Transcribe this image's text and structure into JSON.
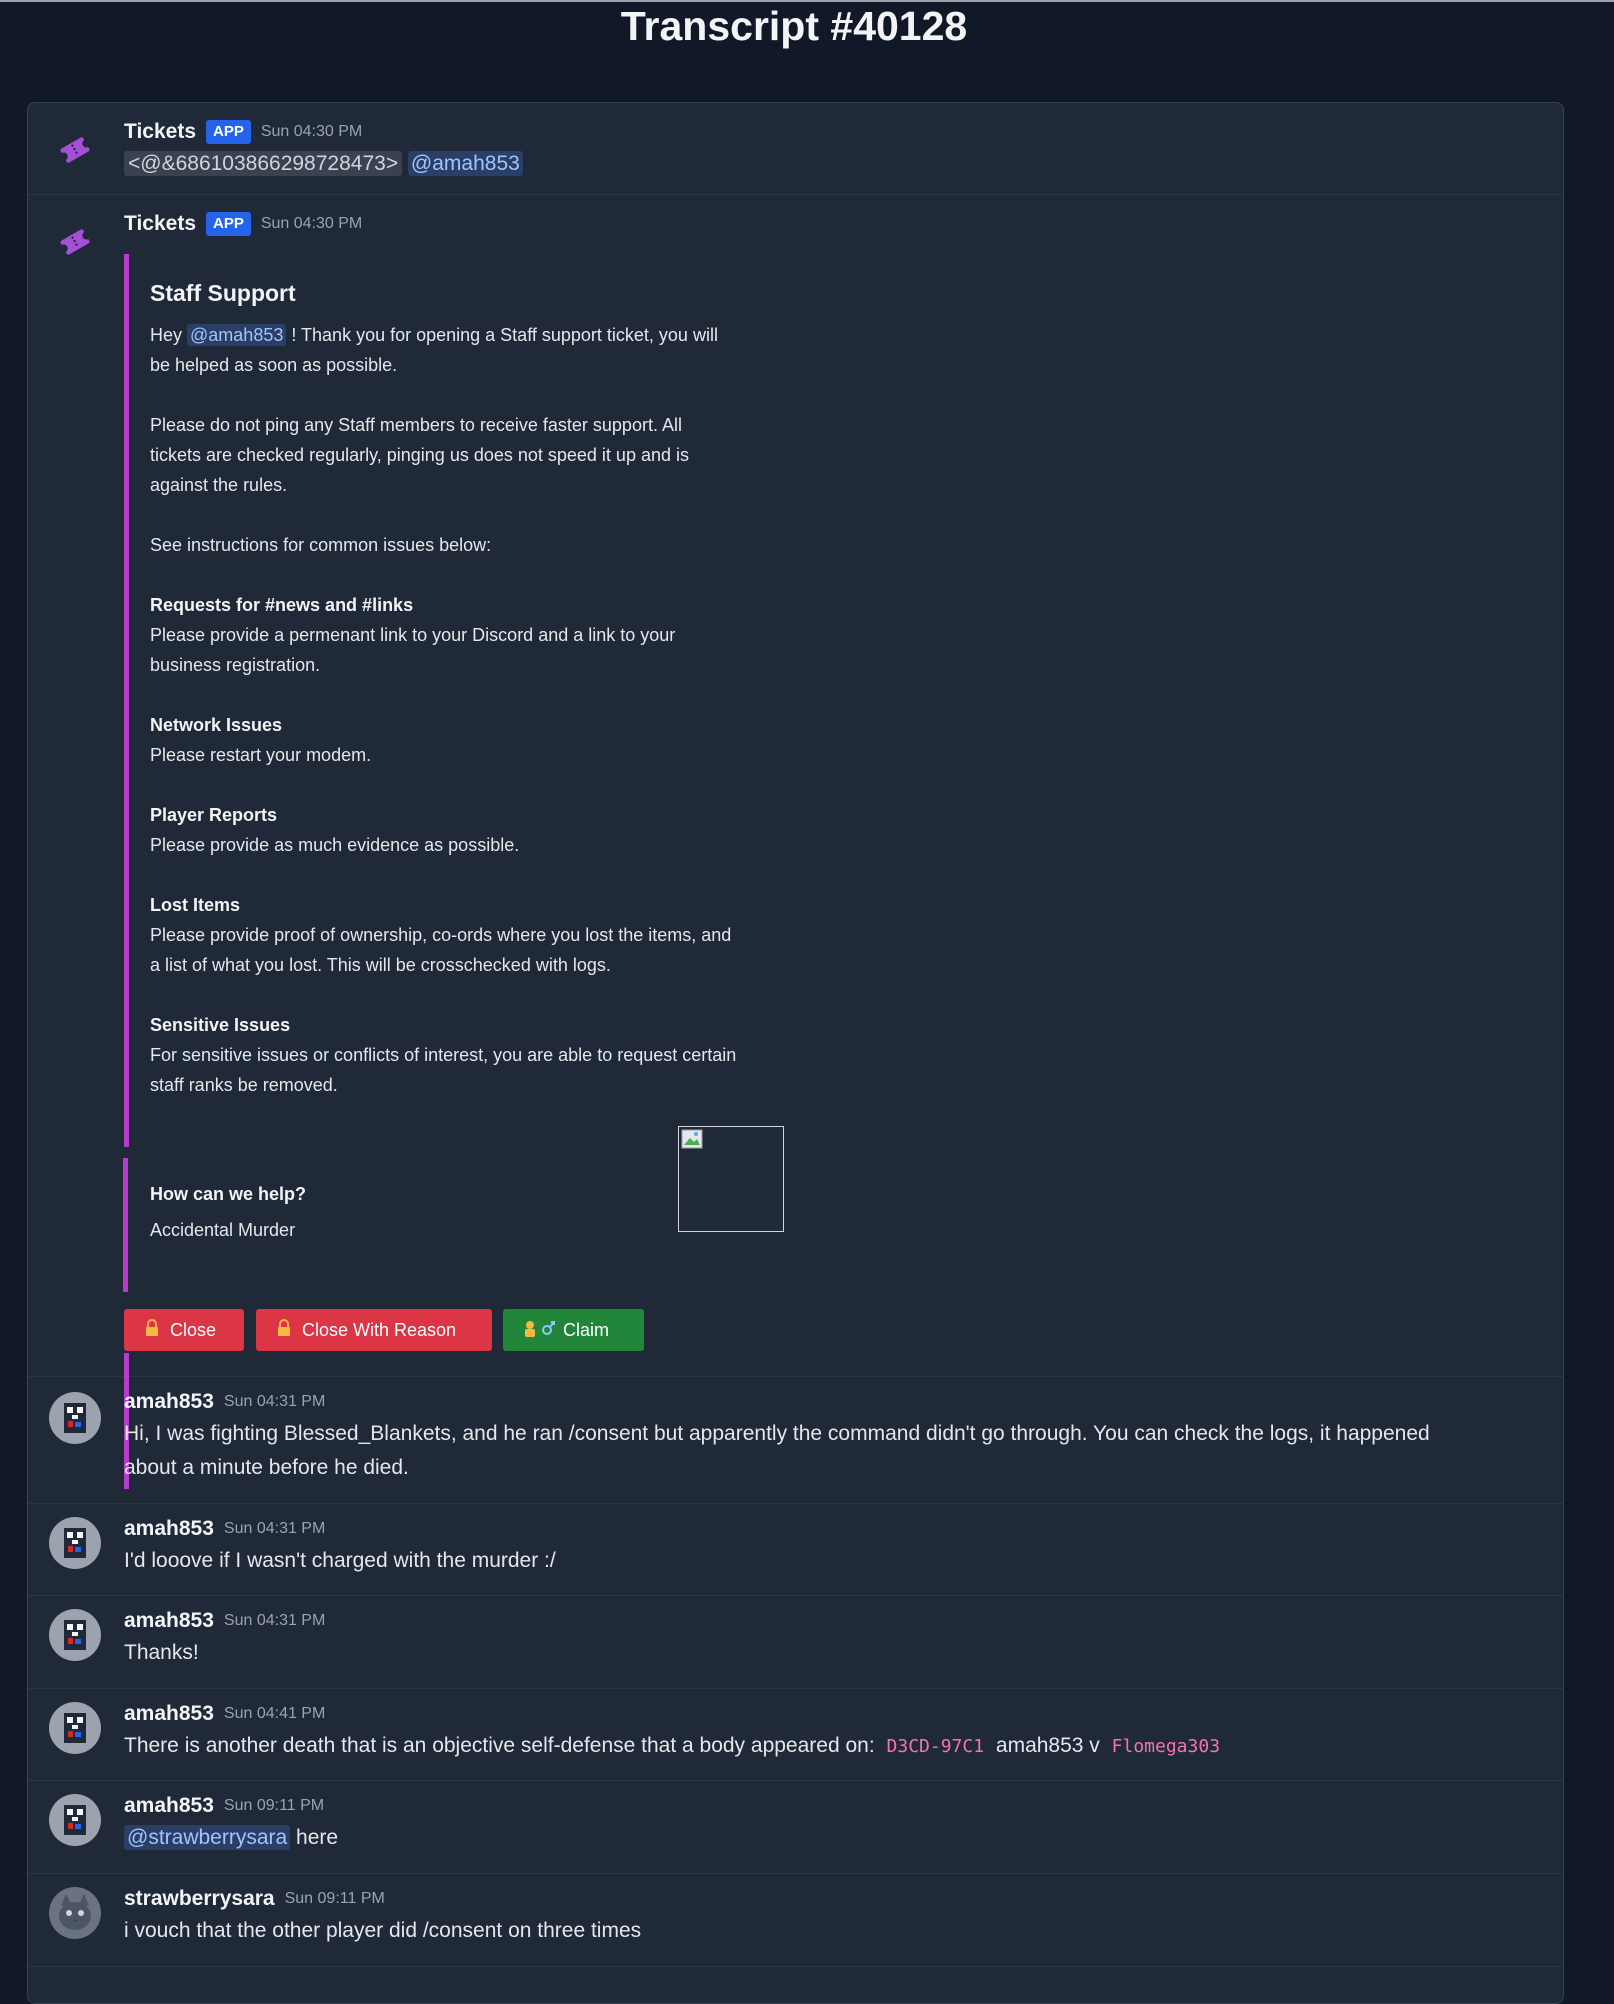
{
  "page": {
    "title": "Transcript #40128"
  },
  "messages": [
    {
      "author": "Tickets",
      "badge": "APP",
      "time": "Sun 04:30 PM",
      "role_mention": "<@&686103866298728473>",
      "mention": "@amah853"
    },
    {
      "author": "Tickets",
      "badge": "APP",
      "time": "Sun 04:30 PM",
      "embed": {
        "title": "Staff Support",
        "intro_pre": "Hey ",
        "intro_mention": "@amah853",
        "intro_post": " ! Thank you for opening a Staff support ticket, you will",
        "intro_line2": "be helped as soon as possible.",
        "p2_l1": "Please do not ping any Staff members to receive faster support. All",
        "p2_l2": "tickets are checked regularly, pinging us does not speed it up and is",
        "p2_l3": "against the rules.",
        "p3": "See instructions for common issues below:",
        "s1_title": "Requests for #news and #links",
        "s1_l1": "Please provide a permenant link to your Discord and a link to your",
        "s1_l2": "business registration.",
        "s2_title": "Network Issues",
        "s2_l1": "Please restart your modem.",
        "s3_title": "Player Reports",
        "s3_l1": "Please provide as much evidence as possible.",
        "s4_title": "Lost Items",
        "s4_l1": "Please provide proof of ownership, co-ords where you lost the items, and",
        "s4_l2": "a list of what you lost. This will be crosschecked with logs.",
        "s5_title": "Sensitive Issues",
        "s5_l1": "For sensitive issues or conflicts of interest, you are able to request certain",
        "s5_l2": "staff ranks be removed.",
        "field_name": "How can we help?",
        "field_value": "Accidental Murder"
      },
      "buttons": {
        "close": "Close",
        "close_reason": "Close With Reason",
        "claim": "Claim"
      }
    },
    {
      "author": "amah853",
      "time": "Sun 04:31 PM",
      "line1": "Hi, I was fighting Blessed_Blankets, and he ran /consent but apparently the command didn't go through. You can check the logs, it happened",
      "line2": "about a minute before he died."
    },
    {
      "author": "amah853",
      "time": "Sun 04:31 PM",
      "text": "I'd looove if I wasn't charged with the murder :/"
    },
    {
      "author": "amah853",
      "time": "Sun 04:31 PM",
      "text": "Thanks!"
    },
    {
      "author": "amah853",
      "time": "Sun 04:41 PM",
      "pre": "There is another death that is an objective self-defense that a body appeared on:",
      "code1": "D3CD-97C1",
      "mid": "amah853 v",
      "code2": "Flomega303"
    },
    {
      "author": "amah853",
      "time": "Sun 09:11 PM",
      "mention": "@strawberrysara",
      "post": " here"
    },
    {
      "author": "strawberrysara",
      "time": "Sun 09:11 PM",
      "text": "i vouch that the other player did /consent on three times"
    }
  ],
  "colors": {
    "embed_bar": "#b83bd1",
    "badge": "#2563eb",
    "danger": "#dc3545",
    "success": "#22863a"
  }
}
